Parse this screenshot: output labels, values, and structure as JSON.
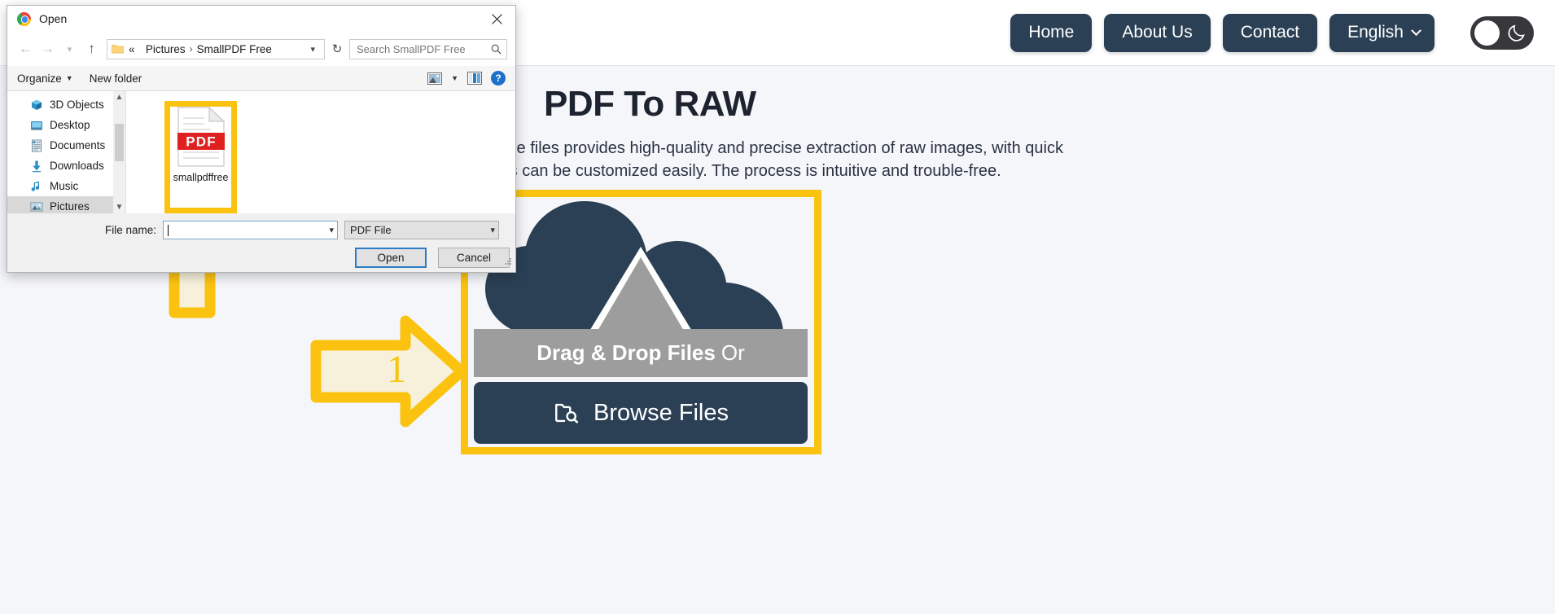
{
  "site": {
    "nav": [
      {
        "label": "Home",
        "name": "nav-home"
      },
      {
        "label": "About Us",
        "name": "nav-about-us"
      },
      {
        "label": "Contact",
        "name": "nav-contact"
      }
    ],
    "language": "English",
    "theme_toggle_icon": "moon-icon",
    "title": "PDF To RAW",
    "description": "Converting PDF or image files provides high-quality and precise extraction of raw images, with quick processing, and settings can be customized easily. The process is intuitive and trouble-free.",
    "dropzone": {
      "cloud_icon": "cloud-upload-icon",
      "drag_text_strong": "Drag & Drop Files",
      "drag_text_light": "Or",
      "browse_icon": "folder-search-icon",
      "browse_label": "Browse Files"
    },
    "colors": {
      "accent_dark": "#2b4055",
      "highlight_yellow": "#fbc310",
      "page_bg": "#f5f6fa",
      "grey_bar": "#9d9d9d"
    }
  },
  "annotations": [
    {
      "id": "1",
      "direction": "right",
      "name": "annotation-arrow-1"
    },
    {
      "id": "2",
      "direction": "up",
      "name": "annotation-arrow-2"
    }
  ],
  "dialog": {
    "title": "Open",
    "app_icon": "chrome-logo-icon",
    "close_icon": "close-icon",
    "nav": {
      "back_icon": "arrow-left-icon",
      "forward_icon": "arrow-right-icon",
      "recent_icon": "chevron-down-icon",
      "up_icon": "arrow-up-icon"
    },
    "address": {
      "folder_icon": "folder-icon",
      "prefix": "«",
      "crumbs": [
        "Pictures",
        "SmallPDF Free"
      ],
      "dropdown_icon": "chevron-down-icon",
      "refresh_icon": "refresh-icon"
    },
    "search": {
      "placeholder": "Search SmallPDF Free",
      "icon": "search-icon"
    },
    "toolbar": {
      "organize": "Organize",
      "new_folder": "New folder",
      "view_icon": "view-layout-icon",
      "view_caret": "chevron-down-icon",
      "preview_icon": "preview-pane-icon",
      "help_icon": "help-icon",
      "help_glyph": "?"
    },
    "sidebar": [
      {
        "label": "3D Objects",
        "icon": "3d-objects-icon"
      },
      {
        "label": "Desktop",
        "icon": "desktop-icon"
      },
      {
        "label": "Documents",
        "icon": "documents-icon"
      },
      {
        "label": "Downloads",
        "icon": "downloads-icon"
      },
      {
        "label": "Music",
        "icon": "music-icon"
      },
      {
        "label": "Pictures",
        "icon": "pictures-icon",
        "selected": true
      }
    ],
    "scrollbar": {
      "up_icon": "chevron-up-icon",
      "down_icon": "chevron-down-icon"
    },
    "files": [
      {
        "name": "smallpdffree",
        "type": "PDF",
        "icon": "pdf-file-icon",
        "highlighted": true
      }
    ],
    "footer": {
      "file_name_label": "File name:",
      "file_name_value": "",
      "file_name_dropdown_icon": "chevron-down-icon",
      "file_type_value": "PDF File",
      "file_type_dropdown_icon": "chevron-down-icon",
      "open_label": "Open",
      "cancel_label": "Cancel",
      "resize_grip_icon": "resize-grip-icon"
    }
  }
}
